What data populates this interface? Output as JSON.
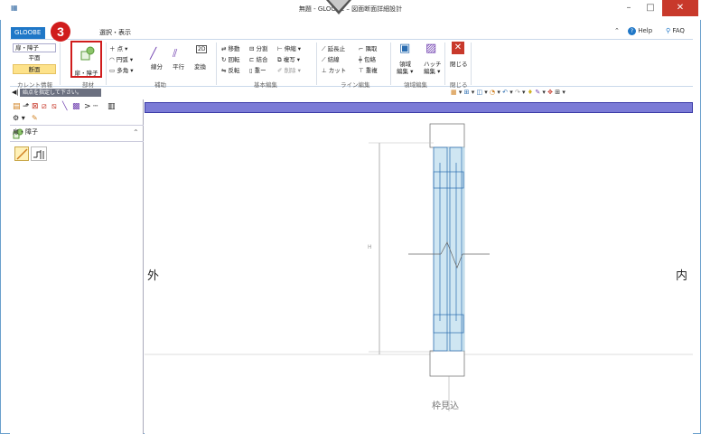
{
  "window": {
    "title": "無題 - GLOOBE – 図面断面詳細設計",
    "help": "Help",
    "faq": "FAQ"
  },
  "tabs": [
    {
      "label": "GLOOBE"
    },
    {
      "label": "選択・表示"
    }
  ],
  "ribbon": {
    "current_info": {
      "select_value": "扉・障子",
      "plan": "平面",
      "section": "断面",
      "group_label": "カレント情報"
    },
    "member": {
      "button_label": "扉・障子",
      "group_label": "部材",
      "step_number": "3"
    },
    "aux": {
      "point": "点",
      "arc": "円弧",
      "polygon": "多角",
      "segment": "線分",
      "parallel": "平行",
      "convert": "変換",
      "group_label": "補助"
    },
    "basic_edit": {
      "move": "移動",
      "rotate": "回転",
      "flip": "反転",
      "split": "分割",
      "join": "結合",
      "merge": "重ー",
      "extend": "伸縮",
      "copy": "複写",
      "delete": "削除",
      "group_label": "基本編集"
    },
    "line_edit": {
      "extend_stop": "延長止",
      "connect": "結線",
      "cut": "カット",
      "corner": "隅取",
      "wrap": "包絡",
      "overlap": "重複",
      "group_label": "ライン編集"
    },
    "area_edit": {
      "region": "領域",
      "region_edit": "編集",
      "hatch": "ハッチ",
      "hatch_edit": "編集",
      "group_label": "領域編集"
    },
    "close": {
      "label": "閉じる",
      "group_label": "閉じる"
    }
  },
  "hint_bar": {
    "text": "始点を指定して下さい。"
  },
  "left_panel": {
    "category": "扉・障子"
  },
  "canvas": {
    "label_outside": "外",
    "label_inside": "内",
    "label_bottom": "枠見込",
    "dim_mark": "H"
  }
}
